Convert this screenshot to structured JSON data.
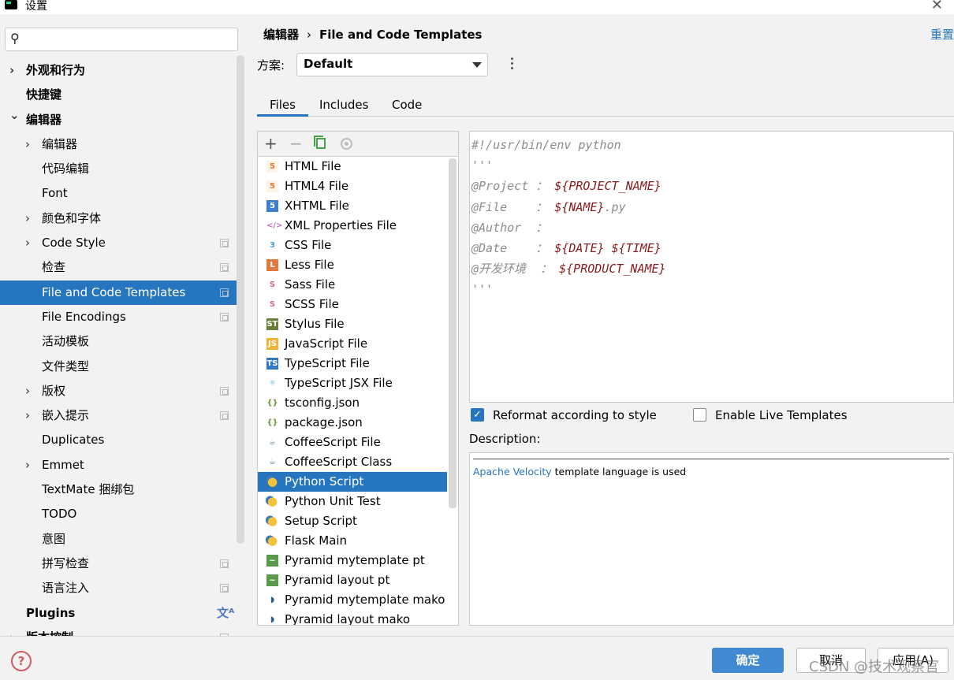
{
  "window": {
    "title": "设置"
  },
  "sidebar": {
    "search_placeholder": "",
    "items": [
      {
        "label": "外观和行为",
        "expand": "collapsed",
        "level": 0,
        "bold": true,
        "copy": false,
        "selected": false
      },
      {
        "label": "快捷键",
        "expand": "none",
        "level": 0,
        "bold": true,
        "copy": false,
        "selected": false
      },
      {
        "label": "编辑器",
        "expand": "expanded",
        "level": 0,
        "bold": true,
        "copy": false,
        "selected": false
      },
      {
        "label": "编辑器",
        "expand": "collapsed",
        "level": 1,
        "bold": false,
        "copy": false,
        "selected": false
      },
      {
        "label": "代码编辑",
        "expand": "none",
        "level": 1,
        "bold": false,
        "copy": false,
        "selected": false
      },
      {
        "label": "Font",
        "expand": "none",
        "level": 1,
        "bold": false,
        "copy": false,
        "selected": false
      },
      {
        "label": "颜色和字体",
        "expand": "collapsed",
        "level": 1,
        "bold": false,
        "copy": false,
        "selected": false
      },
      {
        "label": "Code Style",
        "expand": "collapsed",
        "level": 1,
        "bold": false,
        "copy": true,
        "selected": false
      },
      {
        "label": "检查",
        "expand": "none",
        "level": 1,
        "bold": false,
        "copy": true,
        "selected": false
      },
      {
        "label": "File and Code Templates",
        "expand": "none",
        "level": 1,
        "bold": false,
        "copy": true,
        "selected": true
      },
      {
        "label": "File Encodings",
        "expand": "none",
        "level": 1,
        "bold": false,
        "copy": true,
        "selected": false
      },
      {
        "label": "活动模板",
        "expand": "none",
        "level": 1,
        "bold": false,
        "copy": false,
        "selected": false
      },
      {
        "label": "文件类型",
        "expand": "none",
        "level": 1,
        "bold": false,
        "copy": false,
        "selected": false
      },
      {
        "label": "版权",
        "expand": "collapsed",
        "level": 1,
        "bold": false,
        "copy": true,
        "selected": false
      },
      {
        "label": "嵌入提示",
        "expand": "collapsed",
        "level": 1,
        "bold": false,
        "copy": true,
        "selected": false
      },
      {
        "label": "Duplicates",
        "expand": "none",
        "level": 1,
        "bold": false,
        "copy": false,
        "selected": false
      },
      {
        "label": "Emmet",
        "expand": "collapsed",
        "level": 1,
        "bold": false,
        "copy": false,
        "selected": false
      },
      {
        "label": "TextMate 捆绑包",
        "expand": "none",
        "level": 1,
        "bold": false,
        "copy": false,
        "selected": false
      },
      {
        "label": "TODO",
        "expand": "none",
        "level": 1,
        "bold": false,
        "copy": false,
        "selected": false
      },
      {
        "label": "意图",
        "expand": "none",
        "level": 1,
        "bold": false,
        "copy": false,
        "selected": false
      },
      {
        "label": "拼写检查",
        "expand": "none",
        "level": 1,
        "bold": false,
        "copy": true,
        "selected": false
      },
      {
        "label": "语言注入",
        "expand": "none",
        "level": 1,
        "bold": false,
        "copy": true,
        "selected": false
      },
      {
        "label": "Plugins",
        "expand": "none",
        "level": 0,
        "bold": true,
        "copy": false,
        "translate": true,
        "selected": false
      },
      {
        "label": "版本控制",
        "expand": "collapsed",
        "level": 0,
        "bold": true,
        "copy": true,
        "selected": false
      }
    ]
  },
  "header": {
    "breadcrumb_parent": "编辑器",
    "breadcrumb_sep": "›",
    "breadcrumb_current": "File and Code Templates",
    "reset_label": "重置"
  },
  "scheme": {
    "label": "方案:",
    "value": "Default"
  },
  "tabs": [
    "Files",
    "Includes",
    "Code"
  ],
  "active_tab": "Files",
  "file_list": [
    {
      "label": "HTML File",
      "icon": "html5-icon",
      "selected": false
    },
    {
      "label": "HTML4 File",
      "icon": "html5-icon",
      "selected": false
    },
    {
      "label": "XHTML File",
      "icon": "html5-blue-icon",
      "selected": false
    },
    {
      "label": "XML Properties File",
      "icon": "xml-icon",
      "selected": false
    },
    {
      "label": "CSS File",
      "icon": "css3-icon",
      "selected": false
    },
    {
      "label": "Less File",
      "icon": "less-icon",
      "selected": false
    },
    {
      "label": "Sass File",
      "icon": "sass-icon",
      "selected": false
    },
    {
      "label": "SCSS File",
      "icon": "sass-icon",
      "selected": false
    },
    {
      "label": "Stylus File",
      "icon": "stylus-icon",
      "selected": false
    },
    {
      "label": "JavaScript File",
      "icon": "javascript-icon",
      "selected": false
    },
    {
      "label": "TypeScript File",
      "icon": "typescript-icon",
      "selected": false
    },
    {
      "label": "TypeScript JSX File",
      "icon": "react-icon",
      "selected": false
    },
    {
      "label": "tsconfig.json",
      "icon": "json-icon",
      "selected": false
    },
    {
      "label": "package.json",
      "icon": "json-icon",
      "selected": false
    },
    {
      "label": "CoffeeScript File",
      "icon": "coffeescript-icon",
      "selected": false
    },
    {
      "label": "CoffeeScript Class",
      "icon": "coffeescript-icon",
      "selected": false
    },
    {
      "label": "Python Script",
      "icon": "python-icon",
      "selected": true
    },
    {
      "label": "Python Unit Test",
      "icon": "python-icon",
      "selected": false
    },
    {
      "label": "Setup Script",
      "icon": "python-icon",
      "selected": false
    },
    {
      "label": "Flask Main",
      "icon": "python-icon",
      "selected": false
    },
    {
      "label": "Pyramid mytemplate pt",
      "icon": "chameleon-icon",
      "selected": false
    },
    {
      "label": "Pyramid layout pt",
      "icon": "chameleon-icon",
      "selected": false
    },
    {
      "label": "Pyramid mytemplate mako",
      "icon": "mako-icon",
      "selected": false
    },
    {
      "label": "Pyramid layout mako",
      "icon": "mako-icon",
      "selected": false
    }
  ],
  "editor": {
    "lines": [
      [
        {
          "t": "#!/usr/bin/env python",
          "k": "c"
        }
      ],
      [
        {
          "t": "'''",
          "k": "c"
        }
      ],
      [
        {
          "t": "@Project ",
          "k": "c"
        },
        {
          "t": "： ",
          "k": "c"
        },
        {
          "t": "${PROJECT_NAME}",
          "k": "v"
        }
      ],
      [
        {
          "t": "@File    ",
          "k": "c"
        },
        {
          "t": "： ",
          "k": "c"
        },
        {
          "t": "${NAME}",
          "k": "v"
        },
        {
          "t": ".py",
          "k": "c"
        }
      ],
      [
        {
          "t": "@Author  ",
          "k": "c"
        },
        {
          "t": "：",
          "k": "c"
        }
      ],
      [
        {
          "t": "@Date    ",
          "k": "c"
        },
        {
          "t": "： ",
          "k": "c"
        },
        {
          "t": "${DATE}",
          "k": "v"
        },
        {
          "t": " ",
          "k": "c"
        },
        {
          "t": "${TIME}",
          "k": "v"
        }
      ],
      [
        {
          "t": "@开发环境  ",
          "k": "c"
        },
        {
          "t": "： ",
          "k": "c"
        },
        {
          "t": "${PRODUCT_NAME}",
          "k": "v"
        }
      ],
      [
        {
          "t": "'''",
          "k": "c"
        }
      ]
    ]
  },
  "options": {
    "reformat_label": "Reformat according to style",
    "reformat_checked": true,
    "live_templates_label": "Enable Live Templates",
    "live_templates_checked": false
  },
  "description": {
    "label": "Description:",
    "link_text": "Apache Velocity",
    "rest_text": " template language is used"
  },
  "footer": {
    "help_label": "?",
    "ok_label": "确定",
    "cancel_label": "取消",
    "apply_label": "应用(A)"
  },
  "watermark": "CSDN @技术观察官",
  "colors": {
    "accent": "#2675bf",
    "selection": "#2675bf",
    "template_var": "#871b1b",
    "comment": "#8c8c8c"
  }
}
